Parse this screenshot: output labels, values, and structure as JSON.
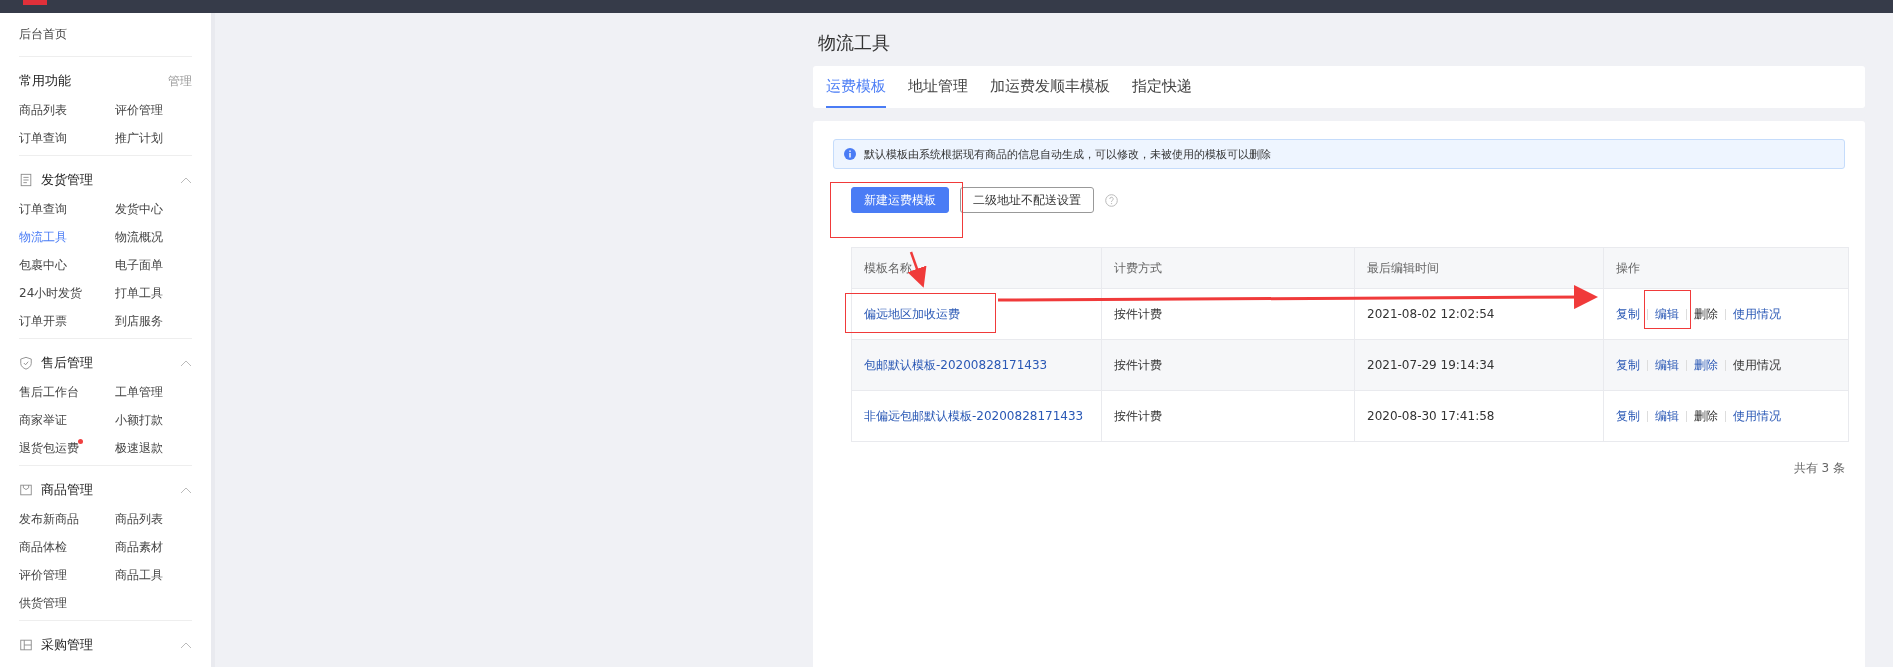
{
  "sidebar": {
    "home": "后台首页",
    "sections": [
      {
        "kind": "shortcut",
        "title": "常用功能",
        "action": "管理",
        "items": [
          {
            "label": "商品列表",
            "selected": false,
            "notification": false
          },
          {
            "label": "评价管理",
            "selected": false,
            "notification": false
          },
          {
            "label": "订单查询",
            "selected": false,
            "notification": false
          },
          {
            "label": "推广计划",
            "selected": false,
            "notification": false
          }
        ]
      },
      {
        "kind": "group",
        "title": "发货管理",
        "expanded": true,
        "items": [
          {
            "label": "订单查询",
            "selected": false,
            "notification": false
          },
          {
            "label": "发货中心",
            "selected": false,
            "notification": false
          },
          {
            "label": "物流工具",
            "selected": true,
            "notification": false
          },
          {
            "label": "物流概况",
            "selected": false,
            "notification": false
          },
          {
            "label": "包裹中心",
            "selected": false,
            "notification": false
          },
          {
            "label": "电子面单",
            "selected": false,
            "notification": false
          },
          {
            "label": "24小时发货",
            "selected": false,
            "notification": false
          },
          {
            "label": "打单工具",
            "selected": false,
            "notification": false
          },
          {
            "label": "订单开票",
            "selected": false,
            "notification": false
          },
          {
            "label": "到店服务",
            "selected": false,
            "notification": false
          }
        ]
      },
      {
        "kind": "group",
        "title": "售后管理",
        "expanded": true,
        "items": [
          {
            "label": "售后工作台",
            "selected": false,
            "notification": false
          },
          {
            "label": "工单管理",
            "selected": false,
            "notification": false
          },
          {
            "label": "商家举证",
            "selected": false,
            "notification": false
          },
          {
            "label": "小额打款",
            "selected": false,
            "notification": false
          },
          {
            "label": "退货包运费",
            "selected": false,
            "notification": true
          },
          {
            "label": "极速退款",
            "selected": false,
            "notification": false
          }
        ]
      },
      {
        "kind": "group",
        "title": "商品管理",
        "expanded": true,
        "items": [
          {
            "label": "发布新商品",
            "selected": false,
            "notification": false
          },
          {
            "label": "商品列表",
            "selected": false,
            "notification": false
          },
          {
            "label": "商品体检",
            "selected": false,
            "notification": false
          },
          {
            "label": "商品素材",
            "selected": false,
            "notification": false
          },
          {
            "label": "评价管理",
            "selected": false,
            "notification": false
          },
          {
            "label": "商品工具",
            "selected": false,
            "notification": false
          },
          {
            "label": "供货管理",
            "selected": false,
            "notification": false
          }
        ]
      },
      {
        "kind": "group",
        "title": "采购管理",
        "expanded": true
      }
    ]
  },
  "page_title": "物流工具",
  "tabs": [
    {
      "label": "运费模板",
      "selected": true
    },
    {
      "label": "地址管理",
      "selected": false
    },
    {
      "label": "加运费发顺丰模板",
      "selected": false
    },
    {
      "label": "指定快递",
      "selected": false
    }
  ],
  "notice": "默认模板由系统根据现有商品的信息自动生成，可以修改，未被使用的模板可以删除",
  "buttons": [
    {
      "kind": "primary",
      "label": "新建运费模板"
    },
    {
      "kind": "default",
      "label": "二级地址不配送设置"
    }
  ],
  "table": {
    "columns": [
      "模板名称",
      "计费方式",
      "最后编辑时间",
      "操作"
    ],
    "rows": [
      {
        "name": "偏远地区加收运费",
        "billing": "按件计费",
        "edited": "2021-08-02 12:02:54",
        "actions": [
          {
            "label": "复制",
            "disabled": false
          },
          {
            "label": "编辑",
            "disabled": false
          },
          {
            "label": "删除",
            "disabled": true
          },
          {
            "label": "使用情况",
            "disabled": false
          }
        ]
      },
      {
        "name": "包邮默认模板-20200828171433",
        "billing": "按件计费",
        "edited": "2021-07-29 19:14:34",
        "actions": [
          {
            "label": "复制",
            "disabled": false
          },
          {
            "label": "编辑",
            "disabled": false
          },
          {
            "label": "删除",
            "disabled": false
          },
          {
            "label": "使用情况",
            "disabled": true
          }
        ]
      },
      {
        "name": "非偏远包邮默认模板-20200828171433",
        "billing": "按件计费",
        "edited": "2020-08-30 17:41:58",
        "actions": [
          {
            "label": "复制",
            "disabled": false
          },
          {
            "label": "编辑",
            "disabled": false
          },
          {
            "label": "删除",
            "disabled": true
          },
          {
            "label": "使用情况",
            "disabled": false
          }
        ]
      }
    ]
  },
  "total": "共有 3 条"
}
